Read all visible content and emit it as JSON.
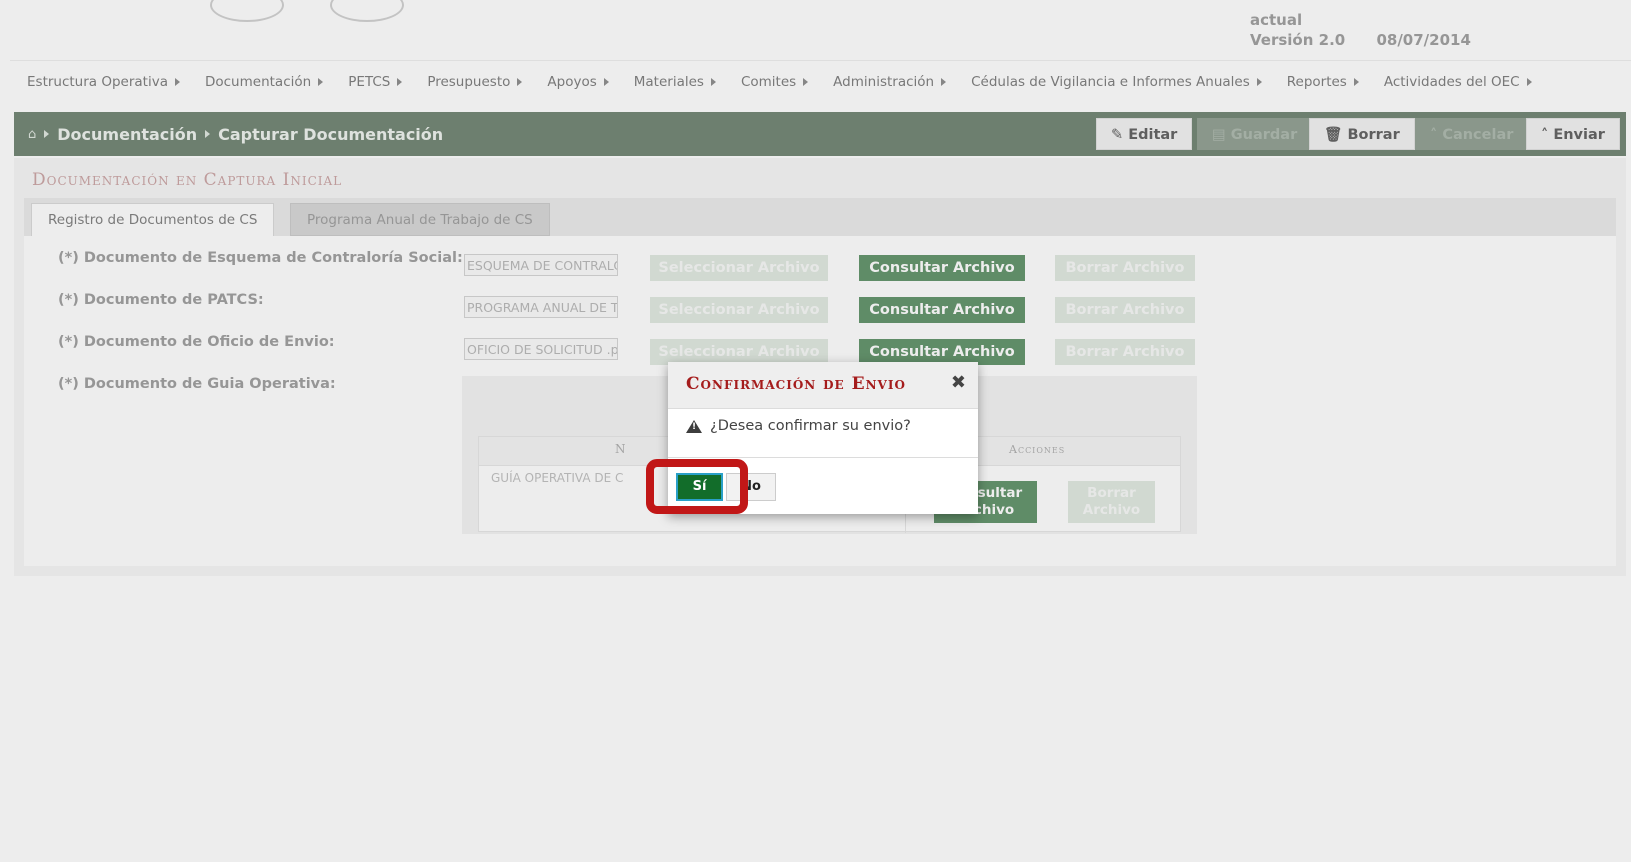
{
  "header": {
    "version_line1": "actual",
    "version_label": "Versión 2.0",
    "version_date": "08/07/2014"
  },
  "nav": {
    "items": [
      "Estructura Operativa",
      "Documentación",
      "PETCS",
      "Presupuesto",
      "Apoyos",
      "Materiales",
      "Comites",
      "Administración",
      "Cédulas de Vigilancia e Informes Anuales",
      "Reportes",
      "Actividades del OEC"
    ]
  },
  "breadcrumb": {
    "section": "Documentación",
    "page": "Capturar Documentación"
  },
  "toolbar": {
    "edit": "Editar",
    "save": "Guardar",
    "delete": "Borrar",
    "cancel": "Cancelar",
    "send": "Enviar"
  },
  "main": {
    "title": "Documentación en Captura Inicial",
    "tabs": [
      {
        "label": "Registro de Documentos de CS"
      },
      {
        "label": "Programa Anual de Trabajo de CS"
      }
    ],
    "rows": [
      {
        "label": "(*) Documento de Esquema de Contraloría Social:",
        "file": "ESQUEMA DE CONTRALORIA"
      },
      {
        "label": "(*) Documento de PATCS:",
        "file": "PROGRAMA ANUAL DE TRABAJO"
      },
      {
        "label": "(*) Documento de Oficio de Envio:",
        "file": "OFICIO DE SOLICITUD .pdf"
      },
      {
        "label": "(*) Documento de Guia Operativa:"
      }
    ],
    "buttons": {
      "select": "Seleccionar Archivo",
      "consult": "Consultar Archivo",
      "delete": "Borrar Archivo"
    },
    "guide_table": {
      "col_name": "N",
      "col_actions": "Acciones",
      "row_name": "GUÍA OPERATIVA DE C",
      "consult_line1": "Consultar",
      "consult_line2": "Archivo",
      "delete_line1": "Borrar",
      "delete_line2": "Archivo"
    }
  },
  "dialog": {
    "title": "Confirmación de Envio",
    "message": "¿Desea confirmar su envio?",
    "yes": "Sí",
    "no": "No"
  }
}
